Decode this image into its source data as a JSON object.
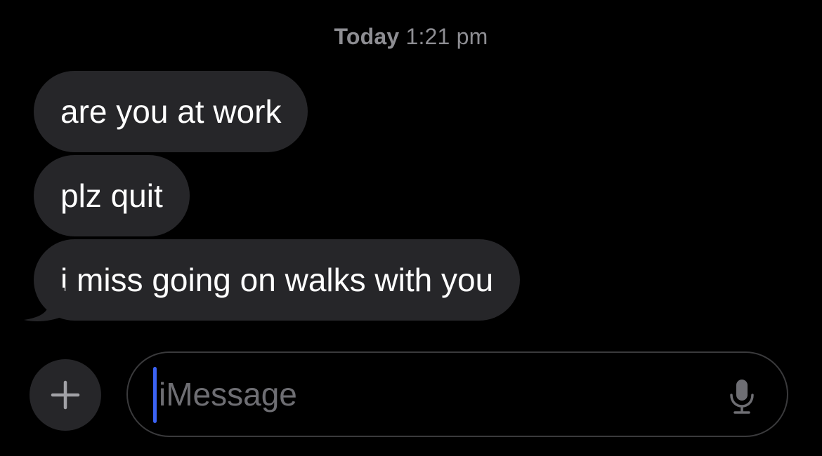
{
  "timestamp": {
    "day": "Today",
    "time": "1:21 pm"
  },
  "messages": [
    {
      "text": "are you at work"
    },
    {
      "text": "plz quit"
    },
    {
      "text": "i miss going on walks with you"
    }
  ],
  "composer": {
    "placeholder": "iMessage",
    "plus_icon": "plus-icon",
    "mic_icon": "microphone-icon"
  },
  "colors": {
    "background": "#000000",
    "bubble": "#262629",
    "caret": "#3b63f5",
    "timestamp": "#8e8e93",
    "placeholder": "#6e6e73"
  }
}
